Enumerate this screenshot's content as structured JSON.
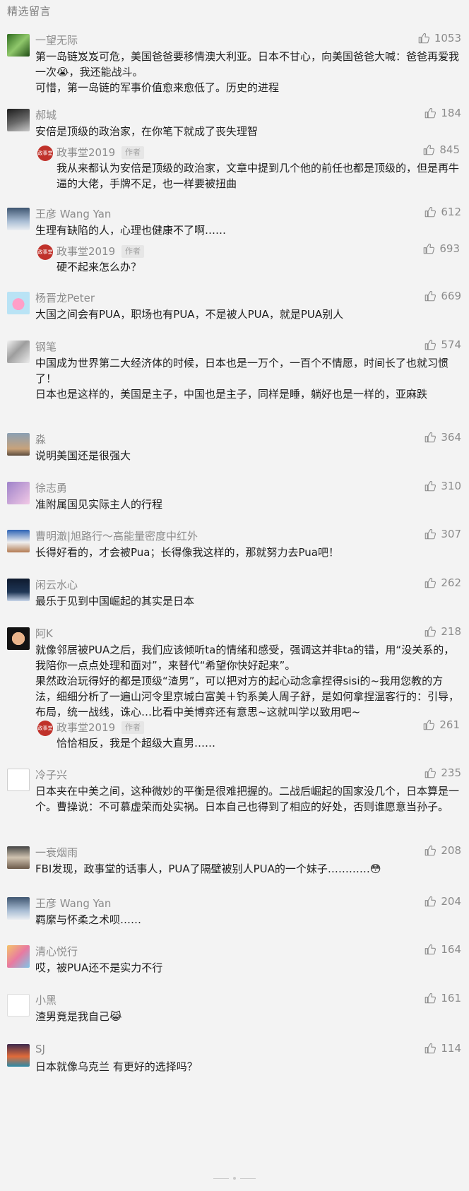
{
  "section_title": "精选留言",
  "comments": [
    {
      "nick": "一望无际",
      "likes": "1053",
      "text": [
        "第一岛链岌岌可危，美国爸爸要移情澳大利亚。日本不甘心，向美国爸爸大喊：爸爸再爱我一次😭，我还能战斗。",
        "可惜，第一岛链的军事价值愈来愈低了。历史的进程"
      ]
    },
    {
      "nick": "郝城",
      "likes": "184",
      "text": [
        "安倍是顶级的政治家，在你笔下就成了丧失理智"
      ],
      "reply": {
        "nick": "政事堂2019",
        "tag": "作者",
        "likes": "845",
        "text": "我从来都认为安倍是顶级的政治家，文章中提到几个他的前任也都是顶级的，但是再牛逼的大佬，手牌不足，也一样要被扭曲"
      }
    },
    {
      "nick": "王彦 Wang Yan",
      "likes": "612",
      "text": [
        "生理有缺陷的人，心理也健康不了啊……"
      ],
      "reply": {
        "nick": "政事堂2019",
        "tag": "作者",
        "likes": "693",
        "text": "硬不起来怎么办？"
      }
    },
    {
      "nick": "杨晋龙Peter",
      "likes": "669",
      "text": [
        "大国之间会有PUA，职场也有PUA，不是被人PUA，就是PUA别人"
      ]
    },
    {
      "nick": "钢笔",
      "likes": "574",
      "text": [
        "中国成为世界第二大经济体的时候，日本也是一万个，一百个不情愿，时间长了也就习惯了！",
        "日本也是这样的，美国是主子，中国也是主子，同样是睡，躺好也是一样的，亚麻跌"
      ]
    },
    {
      "nick": "淼",
      "likes": "364",
      "text": [
        "说明美国还是很强大"
      ]
    },
    {
      "nick": "徐志勇",
      "likes": "310",
      "text": [
        "准附属国见实际主人的行程"
      ]
    },
    {
      "nick": "曹明澈|旭路行～高能量密度中红外",
      "likes": "307",
      "text": [
        "长得好看的，才会被Pua；长得像我这样的，那就努力去Pua吧！"
      ]
    },
    {
      "nick": "闲云水心",
      "likes": "262",
      "text": [
        "最乐于见到中国崛起的其实是日本"
      ]
    },
    {
      "nick": "阿K",
      "likes": "218",
      "text": [
        "就像邻居被PUA之后，我们应该倾听ta的情绪和感受，强调这并非ta的错，用“没关系的，我陪你一点点处理和面对”，来替代“希望你快好起来”。",
        "果然政治玩得好的都是顶级“渣男”，可以把对方的起心动念拿捏得sisi的~我用您教的方法，细细分析了一遍山河令里京城白富美＋钓系美人周子舒，是如何拿捏温客行的：引导，布局，统一战线，诛心…比看中美博弈还有意思~这就叫学以致用吧~"
      ],
      "reply": {
        "nick": "政事堂2019",
        "tag": "作者",
        "likes": "261",
        "text": "恰恰相反，我是个超级大直男……"
      }
    },
    {
      "nick": "冷子兴",
      "likes": "235",
      "text": [
        "日本夹在中美之间，这种微妙的平衡是很难把握的。二战后崛起的国家没几个，日本算是一个。曹操说：不可慕虚荣而处实祸。日本自己也得到了相应的好处，否则谁愿意当孙子。"
      ]
    },
    {
      "nick": "一衰烟雨",
      "likes": "208",
      "text": [
        "FBI发现，政事堂的话事人，PUA了隔壁被别人PUA的一个妹子…………😳"
      ]
    },
    {
      "nick": "王彦 Wang Yan",
      "likes": "204",
      "text": [
        "羁縻与怀柔之术呗……"
      ]
    },
    {
      "nick": "清心悦行",
      "likes": "164",
      "text": [
        "哎，被PUA还不是实力不行"
      ]
    },
    {
      "nick": "小黑",
      "likes": "161",
      "text": [
        "渣男竟是我自己😹"
      ]
    },
    {
      "nick": "SJ",
      "likes": "114",
      "text": [
        "日本就像乌克兰 有更好的选择吗？"
      ]
    }
  ],
  "icons": {
    "like": "thumbs-up-icon",
    "author_avatar": "zhengshitang-seal-icon"
  },
  "colors": {
    "background": "#f3f3f3",
    "meta": "#8b8b8b",
    "text": "#1d1d1d",
    "author_avatar": "#c0312a"
  }
}
